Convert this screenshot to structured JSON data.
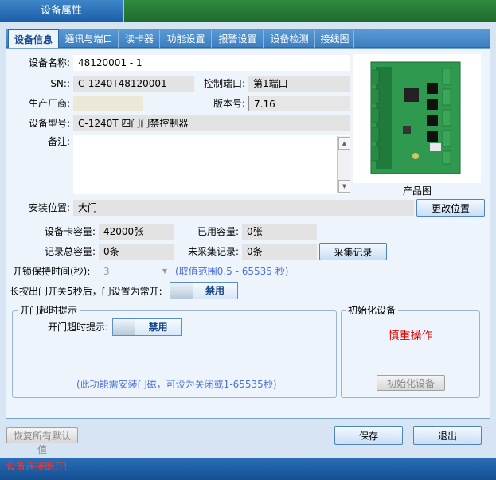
{
  "window": {
    "title": "设备属性"
  },
  "tabs": [
    {
      "label": "设备信息",
      "active": true
    },
    {
      "label": "通讯与端口"
    },
    {
      "label": "读卡器"
    },
    {
      "label": "功能设置"
    },
    {
      "label": "报警设置"
    },
    {
      "label": "设备检测"
    },
    {
      "label": "接线图"
    }
  ],
  "device": {
    "name_label": "设备名称:",
    "name_value": "48120001 - 1",
    "sn_label": "SN::",
    "sn_value": "C-1240T48120001",
    "port_label": "控制端口:",
    "port_value": "第1端口",
    "maker_label": "生产厂商:",
    "maker_value": "",
    "version_label": "版本号:",
    "version_value": "7.16",
    "model_label": "设备型号:",
    "model_value": "C-1240T 四门门禁控制器",
    "remark_label": "备注:",
    "remark_value": "",
    "location_label": "安装位置:",
    "location_value": "大门",
    "change_location_btn": "更改位置",
    "product_image_caption": "产品图"
  },
  "capacity": {
    "card_cap_label": "设备卡容量:",
    "card_cap_value": "42000张",
    "used_cap_label": "已用容量:",
    "used_cap_value": "0张",
    "record_total_label": "记录总容量:",
    "record_total_value": "0条",
    "uncollected_label": "未采集记录:",
    "uncollected_value": "0条",
    "collect_btn": "采集记录"
  },
  "unlock": {
    "hold_label": "开锁保持时间(秒):",
    "hold_value": "3",
    "hold_hint": "(取值范围0.5 - 65535 秒)",
    "long_press_label": "长按出门开关5秒后，门设置为常开:",
    "long_press_toggle": "禁用"
  },
  "timeout_group": {
    "title": "开门超时提示",
    "label": "开门超时提示:",
    "toggle": "禁用",
    "hint": "(此功能需安装门磁，可设为关闭或1-65535秒)"
  },
  "init_group": {
    "title": "初始化设备",
    "warning": "慎重操作",
    "btn": "初始化设备",
    "warning_color": "#e00000"
  },
  "footer": {
    "restore_btn": "恢复所有默认值",
    "save_btn": "保存",
    "exit_btn": "退出"
  },
  "status": {
    "text": "设备连接断开!"
  }
}
